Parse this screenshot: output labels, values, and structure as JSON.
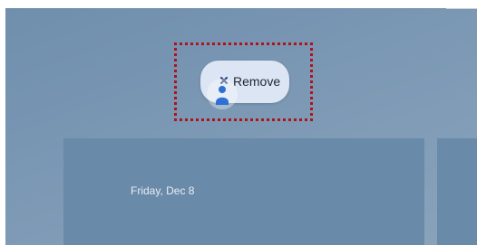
{
  "remove_target": {
    "label": "Remove",
    "icon": "close-icon",
    "highlight_color": "#b0121a"
  },
  "dragged_item": {
    "icon": "person-icon"
  },
  "widget": {
    "date": "Friday, Dec 8"
  }
}
